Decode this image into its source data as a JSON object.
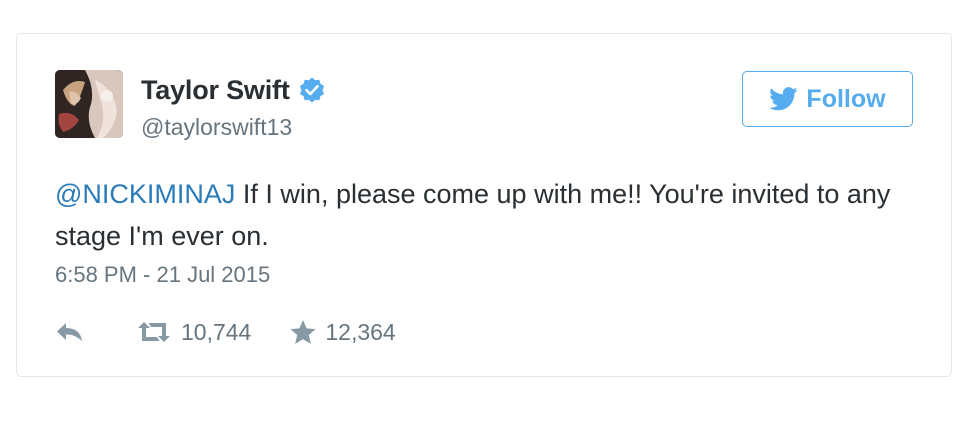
{
  "user": {
    "display_name": "Taylor Swift",
    "handle": "@taylorswift13",
    "verified": true
  },
  "follow_button": {
    "label": "Follow",
    "icon": "twitter-bird-icon"
  },
  "tweet": {
    "mention": "@NICKIMINAJ",
    "text": " If I win, please come up with me!! You're invited to any stage I'm ever on.",
    "timestamp": "6:58 PM - 21 Jul 2015"
  },
  "actions": {
    "reply_icon": "reply-icon",
    "retweet_icon": "retweet-icon",
    "retweet_count": "10,744",
    "favorite_icon": "star-icon",
    "favorite_count": "12,364"
  },
  "colors": {
    "accent": "#55acee",
    "mention": "#2b7bb9",
    "text": "#292f33",
    "muted": "#66757f",
    "border": "#e1e8ed"
  }
}
